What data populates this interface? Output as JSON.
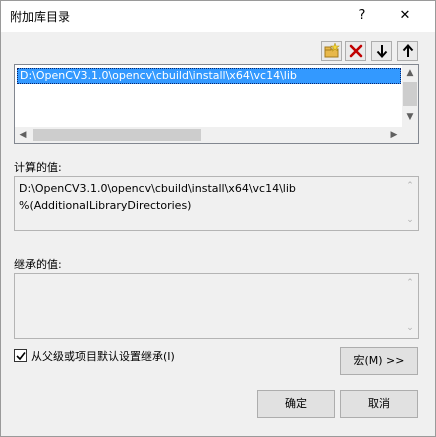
{
  "window": {
    "title": "附加库目录",
    "help_label": "?",
    "close_label": "✕"
  },
  "toolbar": {
    "new_line_icon": "new-folder-icon",
    "delete_icon": "delete-x-icon",
    "move_down_icon": "arrow-down-icon",
    "move_up_icon": "arrow-up-icon",
    "delete_color": "#c00000",
    "folder_color": "#e8b84a"
  },
  "directories": {
    "items": [
      {
        "text": "D:\\OpenCV3.1.0\\opencv\\cbuild\\install\\x64\\vc14\\lib",
        "selected": true
      }
    ],
    "selection_color": "#3399ff"
  },
  "evaluated": {
    "label": "计算的值:",
    "lines": [
      "D:\\OpenCV3.1.0\\opencv\\cbuild\\install\\x64\\vc14\\lib",
      "%(AdditionalLibraryDirectories)"
    ]
  },
  "inherited": {
    "label": "继承的值:",
    "lines": []
  },
  "inherit_option": {
    "label": "从父级或项目默认设置继承(I)",
    "checked": true
  },
  "buttons": {
    "macros": "宏(M) >>",
    "ok": "确定",
    "cancel": "取消"
  }
}
